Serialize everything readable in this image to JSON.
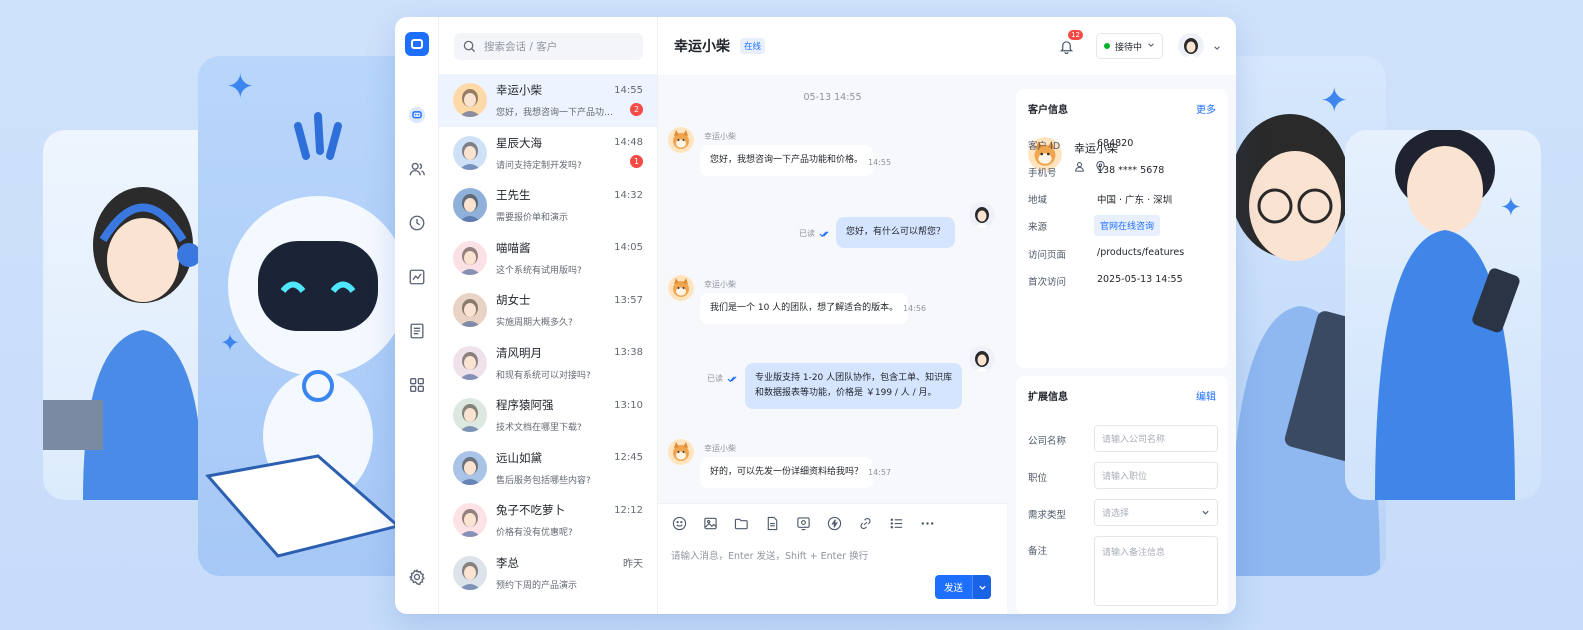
{
  "search": {
    "placeholder": "搜索会话 / 客户"
  },
  "conversations": [
    {
      "name": "幸运小柴",
      "time": "14:55",
      "preview": "您好，我想咨询一下产品功能...",
      "unread": "2",
      "avatar_bg": "#ffd9a8",
      "active": true
    },
    {
      "name": "星辰大海",
      "time": "14:48",
      "preview": "请问支持定制开发吗?",
      "unread": "1",
      "avatar_bg": "#cfe1f7"
    },
    {
      "name": "王先生",
      "time": "14:32",
      "preview": "需要报价单和演示",
      "unread": "",
      "avatar_bg": "#8fb0d8"
    },
    {
      "name": "喵喵酱",
      "time": "14:05",
      "preview": "这个系统有试用版吗?",
      "unread": "",
      "avatar_bg": "#fbe1e6"
    },
    {
      "name": "胡女士",
      "time": "13:57",
      "preview": "实施周期大概多久?",
      "unread": "",
      "avatar_bg": "#e8d3c4"
    },
    {
      "name": "清风明月",
      "time": "13:38",
      "preview": "和现有系统可以对接吗?",
      "unread": "",
      "avatar_bg": "#f0e2ea"
    },
    {
      "name": "程序猿阿强",
      "time": "13:10",
      "preview": "技术文档在哪里下载?",
      "unread": "",
      "avatar_bg": "#dce8e0"
    },
    {
      "name": "远山如黛",
      "time": "12:45",
      "preview": "售后服务包括哪些内容?",
      "unread": "",
      "avatar_bg": "#a9c4e6"
    },
    {
      "name": "兔子不吃萝卜",
      "time": "12:12",
      "preview": "价格有没有优惠呢?",
      "unread": "",
      "avatar_bg": "#fde2e6"
    },
    {
      "name": "李总",
      "time": "昨天",
      "preview": "预约下周的产品演示",
      "unread": "",
      "avatar_bg": "#dde3ea"
    }
  ],
  "chat": {
    "title": "幸运小柴",
    "status": "在线",
    "date_divider": "05-13 14:55",
    "messages": [
      {
        "sender": "幸运小柴",
        "text": "您好，我想咨询一下产品功能和价格。",
        "time": "14:55"
      },
      {
        "text": "您好，有什么可以帮您？",
        "read": "已读"
      },
      {
        "sender": "幸运小柴",
        "text": "我们是一个 10 人的团队，想了解适合的版本。",
        "time": "14:56"
      },
      {
        "text_line1": "专业版支持 1-20 人团队协作，包含工单、知识库",
        "text_line2": "和数据报表等功能，价格是 ￥199 / 人 / 月。",
        "read": "已读"
      },
      {
        "sender": "幸运小柴",
        "text": "好的，可以先发一份详细资料给我吗？",
        "time": "14:57"
      }
    ],
    "composer_placeholder": "请输入消息，Enter 发送，Shift + Enter 换行",
    "send_label": "发送"
  },
  "topbar": {
    "notification_count": "12",
    "agent_status": "接待中"
  },
  "customer": {
    "title": "客户信息",
    "more": "更多",
    "name": "幸运小柴",
    "fields": [
      {
        "label": "客户 ID",
        "value": "684820"
      },
      {
        "label": "手机号",
        "value": "138 **** 5678"
      },
      {
        "label": "地域",
        "value": "中国 · 广东 · 深圳"
      },
      {
        "label": "来源",
        "value": "官网在线咨询"
      },
      {
        "label": "访问页面",
        "value": "/products/features"
      },
      {
        "label": "首次访问",
        "value": "2025-05-13 14:55"
      }
    ]
  },
  "extended": {
    "title": "扩展信息",
    "edit": "编辑",
    "fields": [
      {
        "label": "公司名称",
        "placeholder": "请输入公司名称"
      },
      {
        "label": "职位",
        "placeholder": "请输入职位"
      },
      {
        "label": "需求类型",
        "placeholder": "请选择"
      },
      {
        "label": "备注",
        "placeholder": "请输入备注信息"
      }
    ]
  },
  "colors": {
    "accent": "#1f6fff",
    "badge": "#f54a45",
    "online": "#00b42a"
  }
}
